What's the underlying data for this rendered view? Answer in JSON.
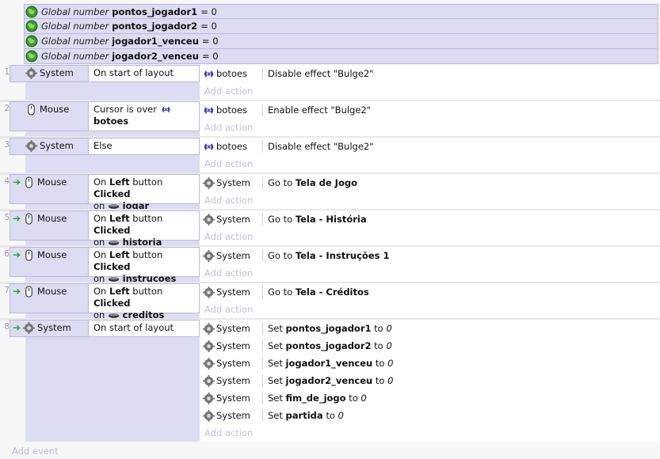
{
  "globals": [
    {
      "keyword": "Global number",
      "name": "pontos_jogador1",
      "value": "= 0"
    },
    {
      "keyword": "Global number",
      "name": "pontos_jogador2",
      "value": "= 0"
    },
    {
      "keyword": "Global number",
      "name": "jogador1_venceu",
      "value": "= 0"
    },
    {
      "keyword": "Global number",
      "name": "jogador2_venceu",
      "value": "= 0"
    }
  ],
  "events": [
    {
      "num": "1",
      "object": "System",
      "condition": "On start of layout",
      "actions": [
        {
          "object": "botoes",
          "text": "Disable effect \"Bulge2\""
        }
      ]
    },
    {
      "num": "2",
      "object": "Mouse",
      "condition_pre": "Cursor is over",
      "condition_obj": "botoes",
      "actions": [
        {
          "object": "botoes",
          "text": "Enable effect \"Bulge2\""
        }
      ]
    },
    {
      "num": "3",
      "object": "System",
      "condition": "Else",
      "actions": [
        {
          "object": "botoes",
          "text": "Disable effect \"Bulge2\""
        }
      ]
    },
    {
      "num": "4",
      "object": "Mouse",
      "click": {
        "on": "On",
        "button": "Left",
        "mid": "button",
        "clicked": "Clicked",
        "on2": "on",
        "target": "jogar"
      },
      "actions": [
        {
          "object": "System",
          "pre": "Go to",
          "target": "Tela de Jogo"
        }
      ]
    },
    {
      "num": "5",
      "object": "Mouse",
      "click": {
        "on": "On",
        "button": "Left",
        "mid": "button",
        "clicked": "Clicked",
        "on2": "on",
        "target": "historia"
      },
      "actions": [
        {
          "object": "System",
          "pre": "Go to",
          "target": "Tela - História"
        }
      ]
    },
    {
      "num": "6",
      "object": "Mouse",
      "click": {
        "on": "On",
        "button": "Left",
        "mid": "button",
        "clicked": "Clicked",
        "on2": "on",
        "target": "instrucoes"
      },
      "actions": [
        {
          "object": "System",
          "pre": "Go to",
          "target": "Tela - Instruções 1"
        }
      ]
    },
    {
      "num": "7",
      "object": "Mouse",
      "click": {
        "on": "On",
        "button": "Left",
        "mid": "button",
        "clicked": "Clicked",
        "on2": "on",
        "target": "creditos"
      },
      "actions": [
        {
          "object": "System",
          "pre": "Go to",
          "target": "Tela - Créditos"
        }
      ]
    },
    {
      "num": "8",
      "object": "System",
      "condition": "On start of layout",
      "actions": [
        {
          "object": "System",
          "pre": "Set",
          "var": "pontos_jogador1",
          "to": "to",
          "val": "0"
        },
        {
          "object": "System",
          "pre": "Set",
          "var": "pontos_jogador2",
          "to": "to",
          "val": "0"
        },
        {
          "object": "System",
          "pre": "Set",
          "var": "jogador1_venceu",
          "to": "to",
          "val": "0"
        },
        {
          "object": "System",
          "pre": "Set",
          "var": "jogador2_venceu",
          "to": "to",
          "val": "0"
        },
        {
          "object": "System",
          "pre": "Set",
          "var": "fim_de_jogo",
          "to": "to",
          "val": "0"
        },
        {
          "object": "System",
          "pre": "Set",
          "var": "partida",
          "to": "to",
          "val": "0"
        }
      ]
    }
  ],
  "add_action_label": "Add action",
  "add_event_label": "Add event",
  "colors": {
    "event_bg": "#dcdcf2",
    "border": "#b9b9de",
    "green_arrow": "#2e9a1e",
    "add_link": "#c0c0e0"
  },
  "icons": {
    "global": "globe-icon",
    "system": "gear-icon",
    "mouse": "mouse-icon",
    "sprite": "invader-icon",
    "button_sprite": "sprite-thumb-icon",
    "trigger": "trigger-arrow-icon"
  }
}
